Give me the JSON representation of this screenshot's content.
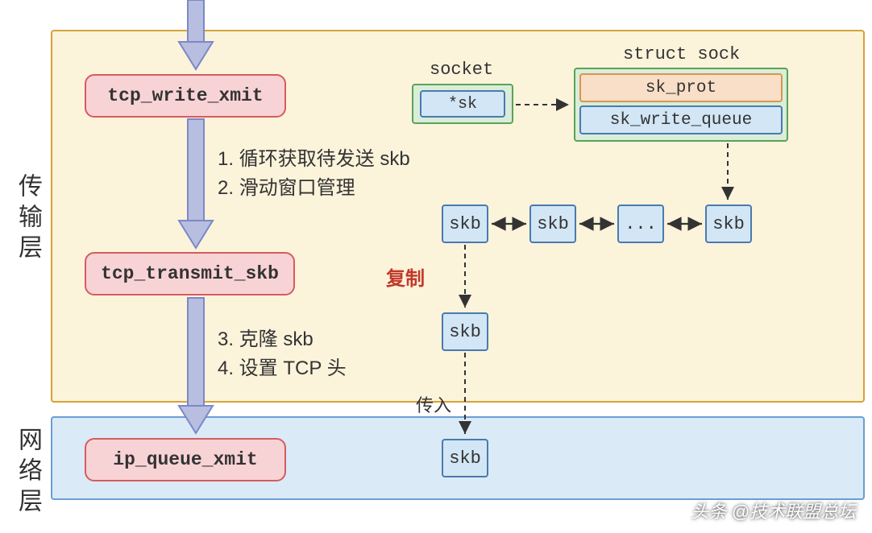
{
  "layers": {
    "transport_label": "传输层",
    "network_label": "网络层"
  },
  "funcs": {
    "tcp_write_xmit": "tcp_write_xmit",
    "tcp_transmit_skb": "tcp_transmit_skb",
    "ip_queue_xmit": "ip_queue_xmit"
  },
  "steps": {
    "s1": "1. 循环获取待发送 skb",
    "s2": "2. 滑动窗口管理",
    "s3": "3. 克隆 skb",
    "s4": "4. 设置 TCP 头"
  },
  "socket": {
    "title": "socket",
    "field": "*sk"
  },
  "sock": {
    "title": "struct sock",
    "sk_prot": "sk_prot",
    "sk_write_queue": "sk_write_queue"
  },
  "queue": {
    "skb": "skb",
    "dots": "..."
  },
  "labels": {
    "copy": "复制",
    "pass": "传入"
  },
  "watermark": "头条 @技术联盟总坛"
}
